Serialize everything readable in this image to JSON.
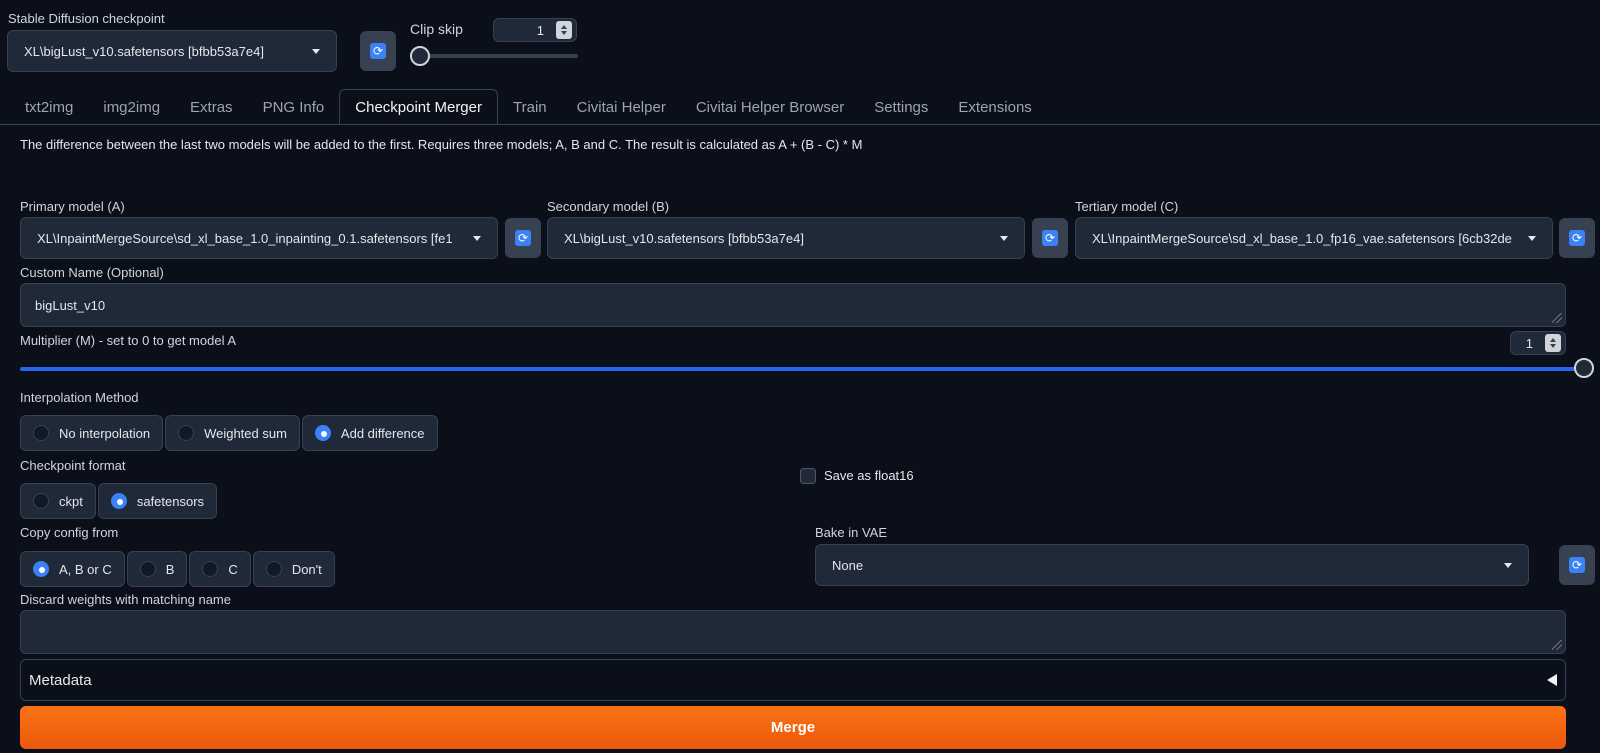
{
  "top": {
    "checkpoint_label": "Stable Diffusion checkpoint",
    "checkpoint_value": "XL\\bigLust_v10.safetensors [bfbb53a7e4]",
    "clip_skip_label": "Clip skip",
    "clip_skip_value": "1",
    "clip_skip_slider_fraction": 0.0
  },
  "tabs": [
    "txt2img",
    "img2img",
    "Extras",
    "PNG Info",
    "Checkpoint Merger",
    "Train",
    "Civitai Helper",
    "Civitai Helper Browser",
    "Settings",
    "Extensions"
  ],
  "active_tab": "Checkpoint Merger",
  "merger": {
    "description": "The difference between the last two models will be added to the first. Requires three models; A, B and C. The result is calculated as A + (B - C) * M",
    "primary_label": "Primary model (A)",
    "primary_value": "XL\\InpaintMergeSource\\sd_xl_base_1.0_inpainting_0.1.safetensors [fe1",
    "secondary_label": "Secondary model (B)",
    "secondary_value": "XL\\bigLust_v10.safetensors [bfbb53a7e4]",
    "tertiary_label": "Tertiary model (C)",
    "tertiary_value": "XL\\InpaintMergeSource\\sd_xl_base_1.0_fp16_vae.safetensors [6cb32de",
    "custom_name_label": "Custom Name (Optional)",
    "custom_name_value": "bigLust_v10",
    "multiplier_label": "Multiplier (M) - set to 0 to get model A",
    "multiplier_value": "1",
    "multiplier_fraction": 1.0,
    "interp_label": "Interpolation Method",
    "interp_options": [
      "No interpolation",
      "Weighted sum",
      "Add difference"
    ],
    "interp_selected": "Add difference",
    "format_label": "Checkpoint format",
    "format_options": [
      "ckpt",
      "safetensors"
    ],
    "format_selected": "safetensors",
    "float16_label": "Save as float16",
    "copy_label": "Copy config from",
    "copy_options": [
      "A, B or C",
      "B",
      "C",
      "Don't"
    ],
    "copy_selected": "A, B or C",
    "vae_label": "Bake in VAE",
    "vae_value": "None",
    "discard_label": "Discard weights with matching name",
    "discard_value": "",
    "metadata_label": "Metadata",
    "merge_label": "Merge"
  },
  "icons": {
    "refresh": "refresh-icon",
    "caret": "chevron-down-icon",
    "collapse": "triangle-left-icon"
  },
  "colors": {
    "background": "#0b0f19",
    "accent": "#3b82f6",
    "merge": "#f97316"
  }
}
